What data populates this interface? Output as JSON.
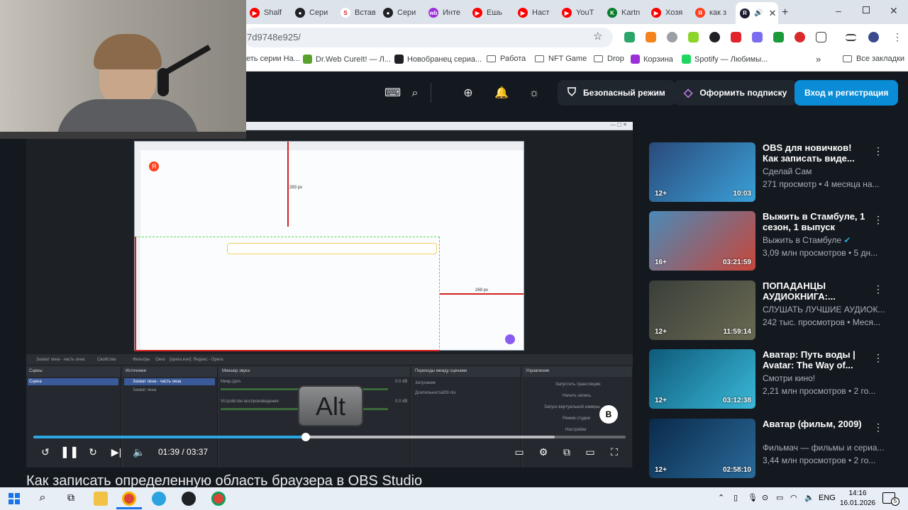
{
  "tabs": [
    {
      "label": "Shalf",
      "color": "#ff0000",
      "glyph": "▶"
    },
    {
      "label": "Сери",
      "color": "#202124",
      "glyph": "●"
    },
    {
      "label": "Встав",
      "color": "#ffffff",
      "glyph": "S"
    },
    {
      "label": "Сери",
      "color": "#202124",
      "glyph": "●"
    },
    {
      "label": "Инте",
      "color": "#9b2fd8",
      "glyph": "wb"
    },
    {
      "label": "Ешь",
      "color": "#ff0000",
      "glyph": "▶"
    },
    {
      "label": "Наст",
      "color": "#ff0000",
      "glyph": "▶"
    },
    {
      "label": "YouT",
      "color": "#ff0000",
      "glyph": "▶"
    },
    {
      "label": "Kartn",
      "color": "#0a7d2c",
      "glyph": "K"
    },
    {
      "label": "Хозя",
      "color": "#ff0000",
      "glyph": "▶"
    },
    {
      "label": "как з",
      "color": "#fc3f1d",
      "glyph": "Я"
    }
  ],
  "active_tab": {
    "glyph": "R",
    "color": "#1a1a2e"
  },
  "address": "7d9748e925/",
  "bookmarks": [
    {
      "label": "еть серии На...",
      "color": "#ffffff"
    },
    {
      "label": "Dr.Web CureIt! — Л...",
      "color": "#5aa02c"
    },
    {
      "label": "Новобранец сериа...",
      "color": "#202124"
    },
    {
      "label": "Работа",
      "color": "folder"
    },
    {
      "label": "NFT Game",
      "color": "folder"
    },
    {
      "label": "Drop",
      "color": "folder"
    },
    {
      "label": "Корзина",
      "color": "#9b2fd8"
    },
    {
      "label": "Spotify — Любимы...",
      "color": "#1ed760"
    }
  ],
  "all_bookmarks": "Все закладки",
  "header": {
    "safe_mode": "Безопасный режим",
    "subscribe": "Оформить подписку",
    "login": "Вход и регистрация"
  },
  "player": {
    "time": "01:39 / 03:37",
    "progress": 0.46,
    "buffered": 0.88,
    "alt_key": "Alt",
    "badge": "B"
  },
  "obs": {
    "scenes_title": "Сцены",
    "scene_item": "Сцена",
    "sources_title": "Источники",
    "source_1": "Захват окна - часть окна",
    "source_2": "Захват окна",
    "mixer_title": "Микшер звука",
    "mixer_1": "Микр./доп.",
    "mixer_2": "Устройство воспроизведения",
    "mixer_db": "0.0 dB",
    "transitions_title": "Переходы между сценами",
    "transition_value": "Затухание",
    "duration_label": "Длительность",
    "duration_value": "300 ms",
    "controls_title": "Управление",
    "ctrl_1": "Запустить трансляцию",
    "ctrl_2": "Начать запись",
    "ctrl_3": "Запуск виртуальной камеры",
    "ctrl_4": "Режим студии",
    "ctrl_5": "Настройки",
    "toolbar_1": "Захват окна - часть окна",
    "toolbar_2": "Свойства",
    "toolbar_3": "Фильтры",
    "toolbar_4": "Окно",
    "toolbar_5": "[opera.exe]: Яндекс - Opera",
    "size_label_1": "283 px",
    "size_label_2": "269 px"
  },
  "video_title": "Как записать определенную область браузера в OBS Studio",
  "recommendations": [
    {
      "title": "OBS для новичков! Как записать виде...",
      "channel": "Сделай Сам",
      "meta": "271 просмотр • 4 месяца на...",
      "duration": "10:03",
      "age": "12+",
      "thumb": "#2a4a7a",
      "thumb2": "#3aa0d8",
      "verified": false
    },
    {
      "title": "Выжить в Стамбуле, 1 сезон, 1 выпуск",
      "channel": "Выжить в Стамбуле",
      "meta": "3,09 млн просмотров • 5 дн...",
      "duration": "03:21:59",
      "age": "16+",
      "thumb": "#4a8ab8",
      "thumb2": "#c8463a",
      "verified": true
    },
    {
      "title": "ПОПАДАНЦЫ АУДИОКНИГА:...",
      "channel": "СЛУШАТЬ ЛУЧШИЕ АУДИОК...",
      "meta": "242 тыс. просмотров • Меся...",
      "duration": "11:59:14",
      "age": "12+",
      "thumb": "#3a3f3a",
      "thumb2": "#6a6a52",
      "verified": false
    },
    {
      "title": "Аватар: Путь воды | Avatar: The Way of...",
      "channel": "Смотри кино!",
      "meta": "2,21 млн просмотров • 2 го...",
      "duration": "03:12:38",
      "age": "12+",
      "thumb": "#0e5a7a",
      "thumb2": "#3ab8d8",
      "verified": false
    },
    {
      "title": "Аватар (фильм, 2009)",
      "channel": "Фильмач — фильмы и сериа...",
      "meta": "3,44 млн просмотров • 2 го...",
      "duration": "02:58:10",
      "age": "12+",
      "thumb": "#0a2a4a",
      "thumb2": "#2a6a9a",
      "verified": false
    }
  ],
  "taskbar": {
    "lang": "ENG",
    "time": "14:16",
    "date": "16.01.2026",
    "notif": "5"
  }
}
